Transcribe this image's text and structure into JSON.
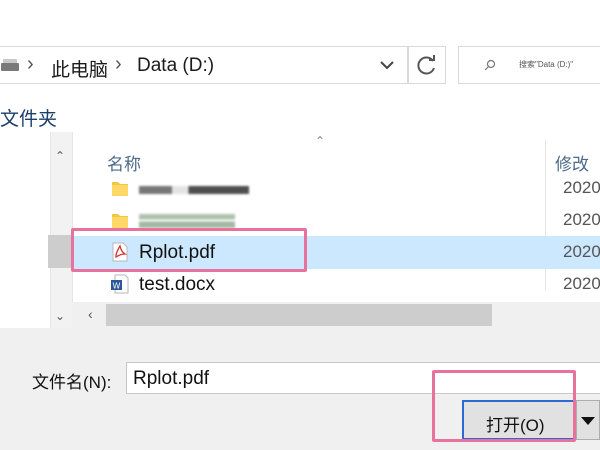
{
  "address_bar": {
    "crumbs": [
      "此电脑",
      "Data (D:)"
    ],
    "search_placeholder": "搜索\"Data (D:)\""
  },
  "toolbar": {
    "new_folder_label": "文件夹"
  },
  "file_list": {
    "columns": {
      "name": "名称",
      "modified": "修改"
    },
    "rows": [
      {
        "name": "",
        "date": "2020",
        "type": "folder",
        "obscured": true
      },
      {
        "name": "",
        "date": "2020",
        "type": "folder",
        "obscured": true
      },
      {
        "name": "Rplot.pdf",
        "date": "2020",
        "type": "pdf",
        "selected": true
      },
      {
        "name": "test.docx",
        "date": "2020",
        "type": "docx"
      }
    ]
  },
  "footer": {
    "filename_label": "文件名(N):",
    "filename_value": "Rplot.pdf",
    "open_button_label": "打开(O)"
  },
  "colors": {
    "selection": "#cce8ff",
    "highlight_annotation": "#e8729e",
    "focus_border": "#2a6bd2"
  }
}
